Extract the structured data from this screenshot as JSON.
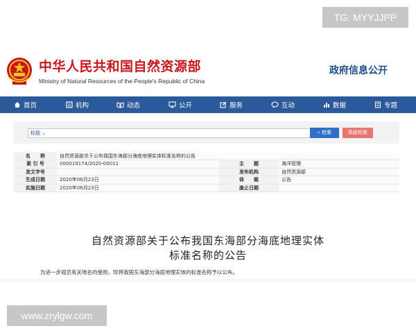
{
  "overlay": {
    "tg_label": "TG: MYYJJPP",
    "watermark_url": "www.zrylgw.com"
  },
  "header": {
    "site_name_cn": "中华人民共和国自然资源部",
    "site_name_en": "Ministry of Natural Resources of the People's Republic of China",
    "gov_info": "政府信息公开",
    "accent_red": "#c8161d",
    "accent_blue": "#1e4d8f"
  },
  "nav": {
    "bg": "#2a5a9a",
    "items": [
      {
        "label": "首页",
        "icon": "home-icon"
      },
      {
        "label": "机构",
        "icon": "organization-icon"
      },
      {
        "label": "动态",
        "icon": "book-icon"
      },
      {
        "label": "公开",
        "icon": "monitor-icon"
      },
      {
        "label": "服务",
        "icon": "edit-icon"
      },
      {
        "label": "互动",
        "icon": "chat-icon"
      },
      {
        "label": "数据",
        "icon": "bar-chart-icon"
      },
      {
        "label": "专题",
        "icon": "document-icon"
      }
    ]
  },
  "search": {
    "select_label": "标题",
    "search_button": "检索",
    "advanced_button": "高级检索"
  },
  "meta": {
    "name_label": "名　　称",
    "name_value": "自然资源部关于公布我国东海部分海底地理实体标准名称的公告",
    "index_label": "索 引 号",
    "index_value": "000019174/2020-00011",
    "topic_label": "主　　题",
    "topic_value": "海洋管理",
    "docno_label": "发文字号",
    "docno_value": "",
    "issuer_label": "发布机构",
    "issuer_value": "自然资源部",
    "created_label": "生成日期",
    "created_value": "2020年06月23日",
    "genre_label": "体　　裁",
    "genre_value": "公告",
    "effective_label": "实施日期",
    "effective_value": "2020年06月23日",
    "abolish_label": "废止日期",
    "abolish_value": ""
  },
  "document": {
    "title_line1": "自然资源部关于公布我国东海部分海底地理实体",
    "title_line2": "标准名称的公告",
    "body_first_line": "为进一步规范有关地名的使用，现将我国东海部分海底地理实体的标准名称予以公布。"
  }
}
